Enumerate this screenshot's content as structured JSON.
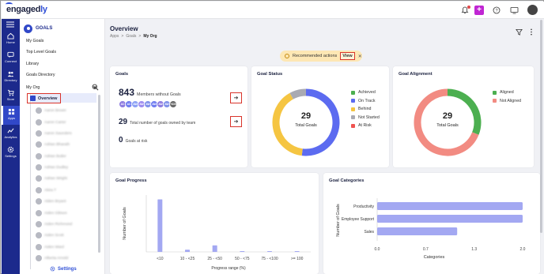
{
  "app": {
    "logo_main": "engaged",
    "logo_accent": "ly"
  },
  "rail": [
    {
      "label": "Home",
      "icon": "home-icon"
    },
    {
      "label": "Connect",
      "icon": "connect-icon"
    },
    {
      "label": "Directory",
      "icon": "directory-icon"
    },
    {
      "label": "Store",
      "icon": "store-icon"
    },
    {
      "label": "Apps",
      "icon": "apps-icon"
    },
    {
      "label": "Analytics",
      "icon": "analytics-icon"
    },
    {
      "label": "Settings",
      "icon": "settings-icon"
    }
  ],
  "sidebar": {
    "header": "GOALS",
    "links": [
      "My Goals",
      "Top Level Goals",
      "Library",
      "Goals Directory"
    ],
    "org_label": "My Org",
    "overview": "Overview",
    "people": [
      "Aaron Brown",
      "Aaron Carter",
      "Aaron Saunders",
      "Adrian Bharath",
      "Adrian Butler",
      "Adrian Dudley",
      "Adrian Wright",
      "Akira T",
      "Alden Bryant",
      "Aiden Gibson",
      "Aiden Richmond",
      "Aiden Scott",
      "Aiden Ward",
      "Alberta Arnold"
    ],
    "settings": "Settings"
  },
  "header": {
    "title": "Overview",
    "crumbs": [
      "Apps",
      ">",
      "Goals",
      ">",
      "My Org"
    ]
  },
  "recommended": {
    "text": "Recommended actions",
    "view": "View",
    "close": "✕"
  },
  "goals_card": {
    "title": "Goals",
    "members_count": "843",
    "members_label": "Members without Goals",
    "avatars": [
      "AC",
      "AC",
      "AW",
      "AW",
      "AW",
      "AW",
      "AW",
      "AW",
      "+835"
    ],
    "total_count": "29",
    "total_label": "Total number of goals owned by team",
    "risk_count": "0",
    "risk_label": "Goals at risk",
    "arrow": "➔"
  },
  "goal_status": {
    "title": "Goal Status",
    "total": "29",
    "total_label": "Total Goals",
    "legend": [
      {
        "label": "Achieved",
        "color": "#4caf50"
      },
      {
        "label": "On Track",
        "color": "#5c6bf0"
      },
      {
        "label": "Behind",
        "color": "#f5c542"
      },
      {
        "label": "Not Started",
        "color": "#a9aab2"
      },
      {
        "label": "At Risk",
        "color": "#ef5350"
      }
    ]
  },
  "goal_alignment": {
    "title": "Goal Alignment",
    "total": "29",
    "total_label": "Total Goals",
    "legend": [
      {
        "label": "Aligned",
        "color": "#4caf50"
      },
      {
        "label": "Not Aligned",
        "color": "#f28b82"
      }
    ]
  },
  "goal_progress": {
    "title": "Goal Progress"
  },
  "goal_categories": {
    "title": "Goal Categories"
  },
  "chart_data": [
    {
      "type": "pie",
      "title": "Goal Status",
      "categories": [
        "Achieved",
        "On Track",
        "Behind",
        "Not Started",
        "At Risk"
      ],
      "values": [
        0,
        13,
        10,
        2,
        0
      ],
      "colors": [
        "#4caf50",
        "#5c6bf0",
        "#f5c542",
        "#a9aab2",
        "#ef5350"
      ]
    },
    {
      "type": "pie",
      "title": "Goal Alignment",
      "categories": [
        "Aligned",
        "Not Aligned"
      ],
      "values": [
        9,
        20
      ],
      "colors": [
        "#4caf50",
        "#f28b82"
      ]
    },
    {
      "type": "bar",
      "title": "Goal Progress",
      "xlabel": "Progress range (%)",
      "ylabel": "Number of Goals",
      "categories": [
        "<10",
        "10 - <25",
        "25 - <50",
        "50 - <75",
        "75 - <100",
        ">= 100"
      ],
      "values": [
        24,
        1,
        3,
        0,
        0,
        0
      ],
      "ylim": [
        0,
        26
      ],
      "color": "#a3a8f2"
    },
    {
      "type": "bar",
      "orientation": "horizontal",
      "title": "Goal Categories",
      "xlabel": "Categories",
      "ylabel": "Number of Goals",
      "categories": [
        "Productivity",
        "Employee Support",
        "Sales"
      ],
      "values": [
        2.0,
        2.0,
        1.1
      ],
      "xticks": [
        "0.0",
        "0.7",
        "1.3",
        "2.0"
      ],
      "xlim": [
        0,
        2.0
      ],
      "color": "#a3a8f2"
    }
  ]
}
